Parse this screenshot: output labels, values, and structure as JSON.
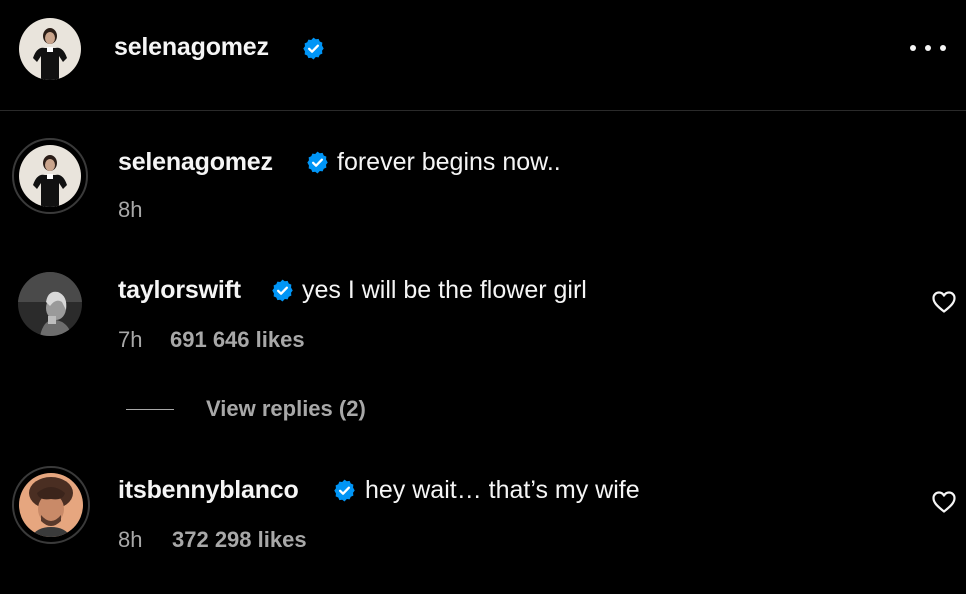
{
  "header": {
    "username": "selenagomez"
  },
  "caption": {
    "username": "selenagomez",
    "text": "forever begins now..",
    "time": "8h"
  },
  "comments": [
    {
      "username": "taylorswift",
      "text": "yes I will be the flower girl",
      "time": "7h",
      "likes": "691 646 likes",
      "view_replies": "View replies (2)"
    },
    {
      "username": "itsbennyblanco",
      "text": "hey wait… that’s my wife",
      "time": "8h",
      "likes": "372 298 likes"
    }
  ],
  "colors": {
    "background": "#000000",
    "text": "#f5f5f5",
    "secondary": "#a8a8a8",
    "verified": "#0095f6"
  },
  "icons": [
    "verified-badge-icon",
    "more-options-icon",
    "heart-icon"
  ]
}
